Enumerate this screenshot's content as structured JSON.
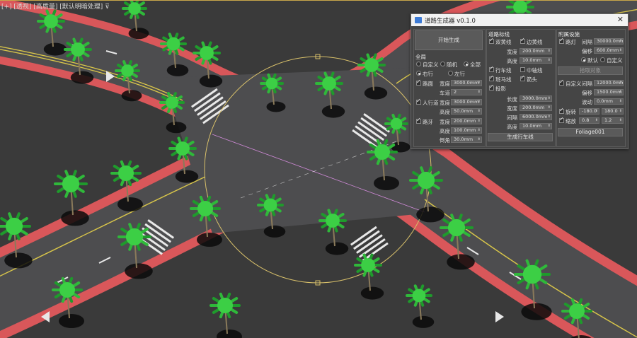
{
  "viewport": {
    "label": "[+] [透视] [高质量] [默认明暗处理]",
    "filter_icon": "filter-icon"
  },
  "dialog": {
    "title": "道路生成器 v0.1.0",
    "close": "✕",
    "col1": {
      "generate_button": "开始生成",
      "section_title": "全局",
      "mode_options": [
        "自定义",
        "随机",
        "全部"
      ],
      "mode_selected": 2,
      "dir_options": [
        "右行",
        "左行"
      ],
      "dir_selected": 0,
      "road": {
        "label": "路面",
        "checked": true,
        "width_label": "宽度",
        "width": "3000.0mm",
        "lanes_label": "车道",
        "lanes": "2"
      },
      "sidewalk": {
        "label": "人行道",
        "checked": true,
        "width_label": "宽度",
        "width": "3000.0mm",
        "height_label": "高度",
        "height": "50.0mm"
      },
      "curb": {
        "label": "路牙",
        "checked": true,
        "width_label": "宽度",
        "width": "200.0mm",
        "height_label": "高度",
        "height": "100.0mm",
        "chamfer_label": "倒角",
        "chamfer": "30.0mm"
      }
    },
    "col2": {
      "section_title": "道路标线",
      "double_yellow": {
        "label": "双黄线",
        "checked": true
      },
      "edge_line": {
        "label": "边黄线",
        "checked": true
      },
      "width_label": "宽度",
      "width": "200.0mm",
      "height_label": "高度",
      "height": "10.0mm",
      "lane_line": {
        "label": "行车线",
        "checked": true
      },
      "center_line": {
        "label": "中轴线",
        "checked": false
      },
      "zebra": {
        "label": "斑马线",
        "checked": true
      },
      "arrow": {
        "label": "箭头",
        "checked": true
      },
      "shadow": {
        "label": "投影",
        "checked": true
      },
      "length_label": "长度",
      "length": "3000.0mm",
      "width2_label": "宽度",
      "width2": "200.0mm",
      "gap_label": "间隔",
      "gap": "6000.0mm",
      "height2_label": "高度",
      "height2": "10.0mm",
      "generate_lane_button": "生成行车线"
    },
    "col3": {
      "section_title": "附属设施",
      "street_light": {
        "label": "路灯",
        "checked": true,
        "spacing_label": "间隔",
        "spacing": "30000.0mm",
        "offset_label": "偏移",
        "offset": "600.0mm"
      },
      "default_option": "默认",
      "custom_option": "自定义",
      "light_mode_selected": 0,
      "pick_button": "拾取对象",
      "custom_plant": {
        "label": "自定义",
        "checked": true,
        "spacing_label": "间隔",
        "spacing": "12000.0mm",
        "offset_label": "偏移",
        "offset": "1500.0mm",
        "jitter_label": "波动",
        "jitter": "0.0mm"
      },
      "rotate": {
        "label": "旋转",
        "checked": true,
        "min": "-180.0",
        "max": "180.0"
      },
      "scale": {
        "label": "缩放",
        "checked": true,
        "min": "0.8",
        "max": "1.2"
      },
      "object_button": "Foliage001"
    }
  }
}
